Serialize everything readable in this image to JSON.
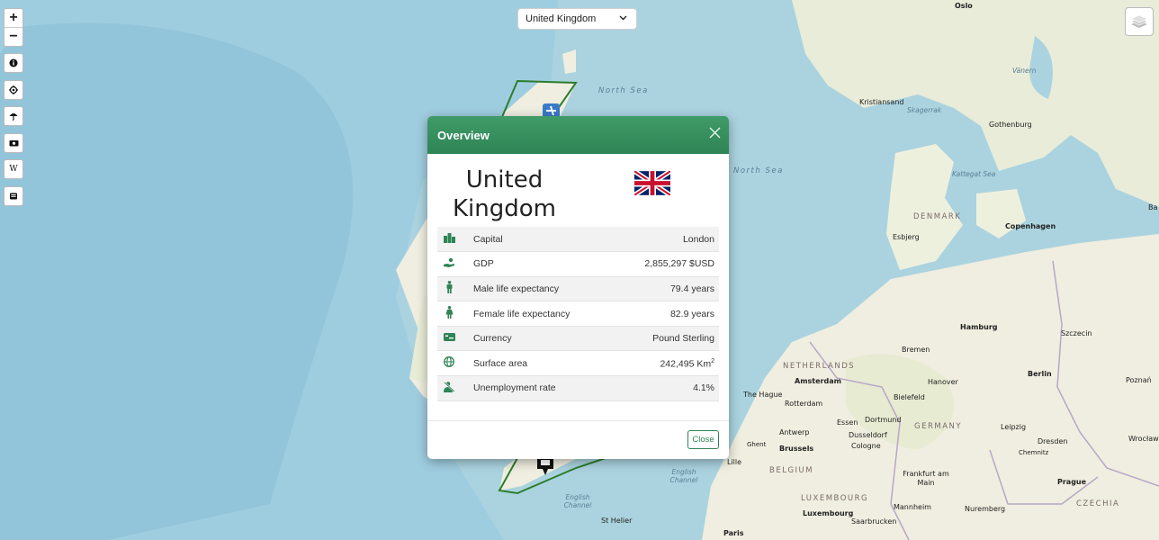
{
  "country_select": {
    "value": "United Kingdom"
  },
  "map_labels": {
    "north_sea_1": "North Sea",
    "north_sea_2": "North Sea",
    "kattegat": "Kattegat Sea",
    "skagerrak": "Skagerrak",
    "english_channel_1": "English Channel",
    "english_channel_2": "English Channel",
    "vanern": "Vänern",
    "denmark": "DENMARK",
    "netherlands": "NETHERLANDS",
    "germany": "GERMANY",
    "belgium": "BELGIUM",
    "luxembourg_c": "LUXEMBOURG",
    "czechia": "CZECHIA",
    "oslo": "Oslo",
    "kristiansand": "Kristiansand",
    "gothenburg": "Gothenburg",
    "copenhagen": "Copenhagen",
    "esbjerg": "Esbjerg",
    "hamburg": "Hamburg",
    "szczecin": "Szczecin",
    "bremen": "Bremen",
    "berlin": "Berlin",
    "amsterdam": "Amsterdam",
    "the_hague": "The Hague",
    "rotterdam": "Rotterdam",
    "hanover": "Hanover",
    "bielefeld": "Bielefeld",
    "poznan": "Poznań",
    "essen": "Essen",
    "dortmund": "Dortmund",
    "antwerp": "Antwerp",
    "dusseldorf": "Dusseldorf",
    "cologne": "Cologne",
    "leipzig": "Leipzig",
    "dresden": "Dresden",
    "chemnitz": "Chemnitz",
    "wroclaw": "Wrocław",
    "brussels": "Brussels",
    "lille": "Lille",
    "ghent": "Ghent",
    "frankfurt": "Frankfurt am Main",
    "prague": "Prague",
    "luxembourg": "Luxembourg",
    "mannheim": "Mannheim",
    "nuremberg": "Nuremberg",
    "saarbrucken": "Saarbrucken",
    "st_helier": "St Helier",
    "paris": "Paris",
    "ba": "Ba"
  },
  "modal": {
    "title": "Overview",
    "country_name": "United Kingdom",
    "close_label": "Close",
    "facts": [
      {
        "icon": "city-icon",
        "label": "Capital",
        "value": "London"
      },
      {
        "icon": "hand-coin-icon",
        "label": "GDP",
        "value": "2,855,297 $USD"
      },
      {
        "icon": "male-icon",
        "label": "Male life expectancy",
        "value": "79.4 years"
      },
      {
        "icon": "female-icon",
        "label": "Female life expectancy",
        "value": "82.9 years"
      },
      {
        "icon": "money-bill-icon",
        "label": "Currency",
        "value": "Pound Sterling"
      },
      {
        "icon": "globe-icon",
        "label": "Surface area",
        "value": "242,495 Km",
        "sup": "2"
      },
      {
        "icon": "unemployed-icon",
        "label": "Unemployment rate",
        "value": "4.1%"
      }
    ]
  },
  "colors": {
    "accent": "#2f8455",
    "sea": "#aad3df",
    "land": "#f2efe9"
  }
}
